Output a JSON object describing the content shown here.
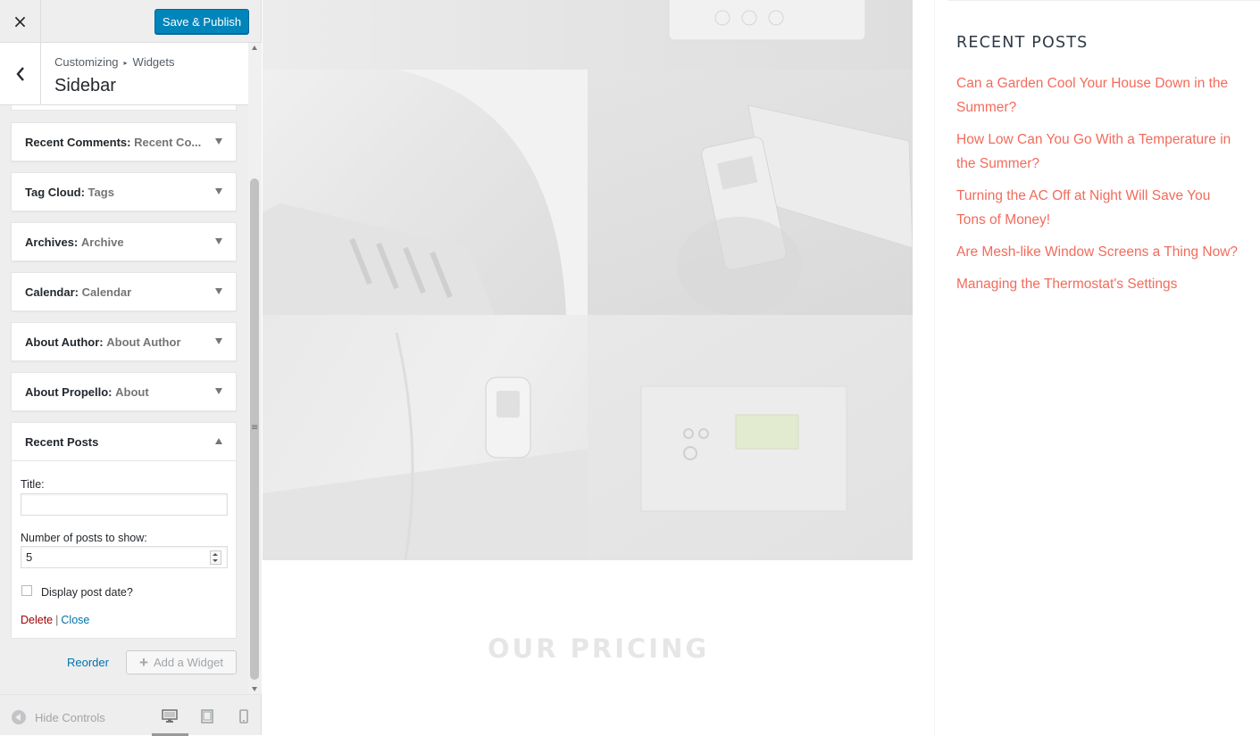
{
  "customizer": {
    "close_icon": "×",
    "save_label": "Save & Publish",
    "breadcrumb": {
      "part1": "Customizing",
      "separator": "▸",
      "part2": "Widgets"
    },
    "section_title": "Sidebar",
    "widgets": [
      {
        "type": "Recent Comments:",
        "title": "Recent Co..."
      },
      {
        "type": "Tag Cloud:",
        "title": "Tags"
      },
      {
        "type": "Archives:",
        "title": "Archive"
      },
      {
        "type": "Calendar:",
        "title": "Calendar"
      },
      {
        "type": "About Author:",
        "title": "About Author"
      },
      {
        "type": "About Propello:",
        "title": "About"
      }
    ],
    "expanded_widget": {
      "type": "Recent Posts",
      "title_label": "Title:",
      "title_value": "",
      "count_label": "Number of posts to show:",
      "count_value": "5",
      "show_date_label": "Display post date?",
      "show_date_checked": false,
      "delete_label": "Delete",
      "actions_separator": "|",
      "close_label": "Close"
    },
    "reorder_label": "Reorder",
    "add_widget_label": "Add a Widget",
    "add_widget_icon": "+",
    "hide_controls_label": "Hide Controls",
    "devices": [
      "desktop-icon",
      "tablet-icon",
      "mobile-icon"
    ],
    "accent_color": "#0085ba"
  },
  "preview": {
    "pricing_heading": "OUR PRICING",
    "sidebar": {
      "heading": "RECENT POSTS",
      "posts": [
        "Can a Garden Cool Your House Down in the Summer?",
        "How Low Can You Go With a Temperature in the Summer?",
        "Turning the AC Off at Night Will Save You Tons of Money!",
        "Are Mesh-like Window Screens a Thing Now?",
        "Managing the Thermostat's Settings"
      ],
      "link_color": "#f26b5b"
    }
  }
}
